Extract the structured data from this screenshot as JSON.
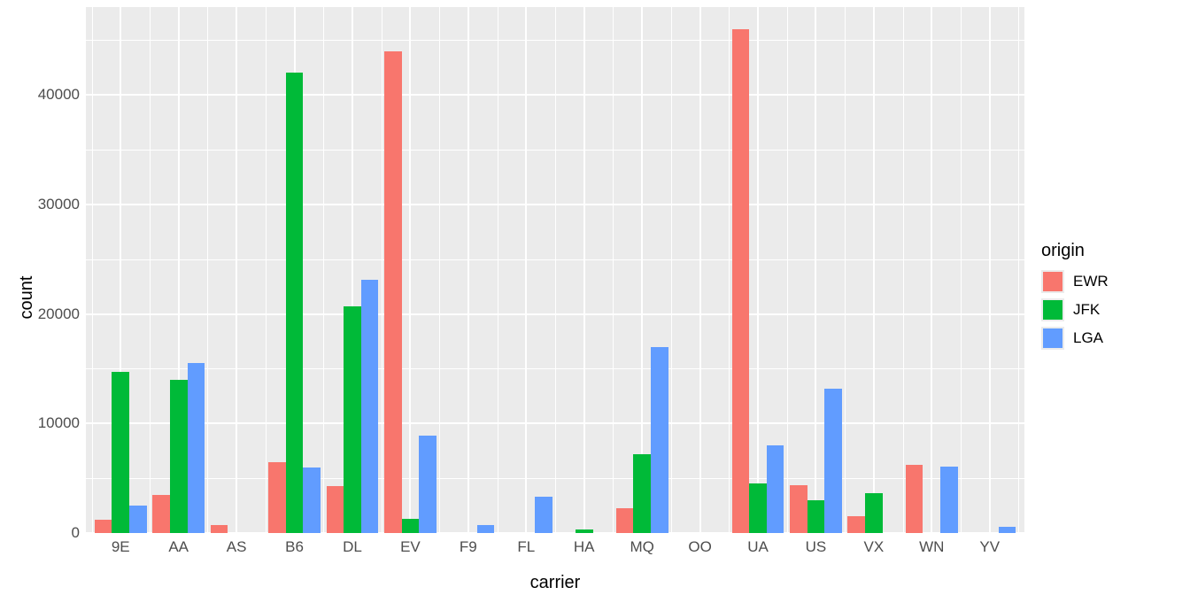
{
  "chart_data": {
    "type": "bar",
    "title": "",
    "xlabel": "carrier",
    "ylabel": "count",
    "ylim": [
      0,
      48000
    ],
    "y_ticks": [
      0,
      10000,
      20000,
      30000,
      40000
    ],
    "categories": [
      "9E",
      "AA",
      "AS",
      "B6",
      "DL",
      "EV",
      "F9",
      "FL",
      "HA",
      "MQ",
      "OO",
      "UA",
      "US",
      "VX",
      "WN",
      "YV"
    ],
    "series": [
      {
        "name": "EWR",
        "color": "#F8766D",
        "values": [
          1200,
          3500,
          700,
          6500,
          4300,
          44000,
          null,
          null,
          null,
          2300,
          null,
          46000,
          4400,
          1500,
          6200,
          null
        ]
      },
      {
        "name": "JFK",
        "color": "#00BA38",
        "values": [
          14700,
          14000,
          null,
          42000,
          20700,
          1300,
          null,
          null,
          350,
          7200,
          null,
          4500,
          3000,
          3600,
          null,
          null
        ]
      },
      {
        "name": "LGA",
        "color": "#619CFF",
        "values": [
          2500,
          15500,
          null,
          6000,
          23100,
          8900,
          700,
          3300,
          null,
          17000,
          null,
          8000,
          13200,
          null,
          6100,
          600
        ]
      }
    ],
    "legend_title": "origin",
    "legend_items": [
      "EWR",
      "JFK",
      "LGA"
    ]
  },
  "colors": {
    "EWR": "#F8766D",
    "JFK": "#00BA38",
    "LGA": "#619CFF"
  }
}
